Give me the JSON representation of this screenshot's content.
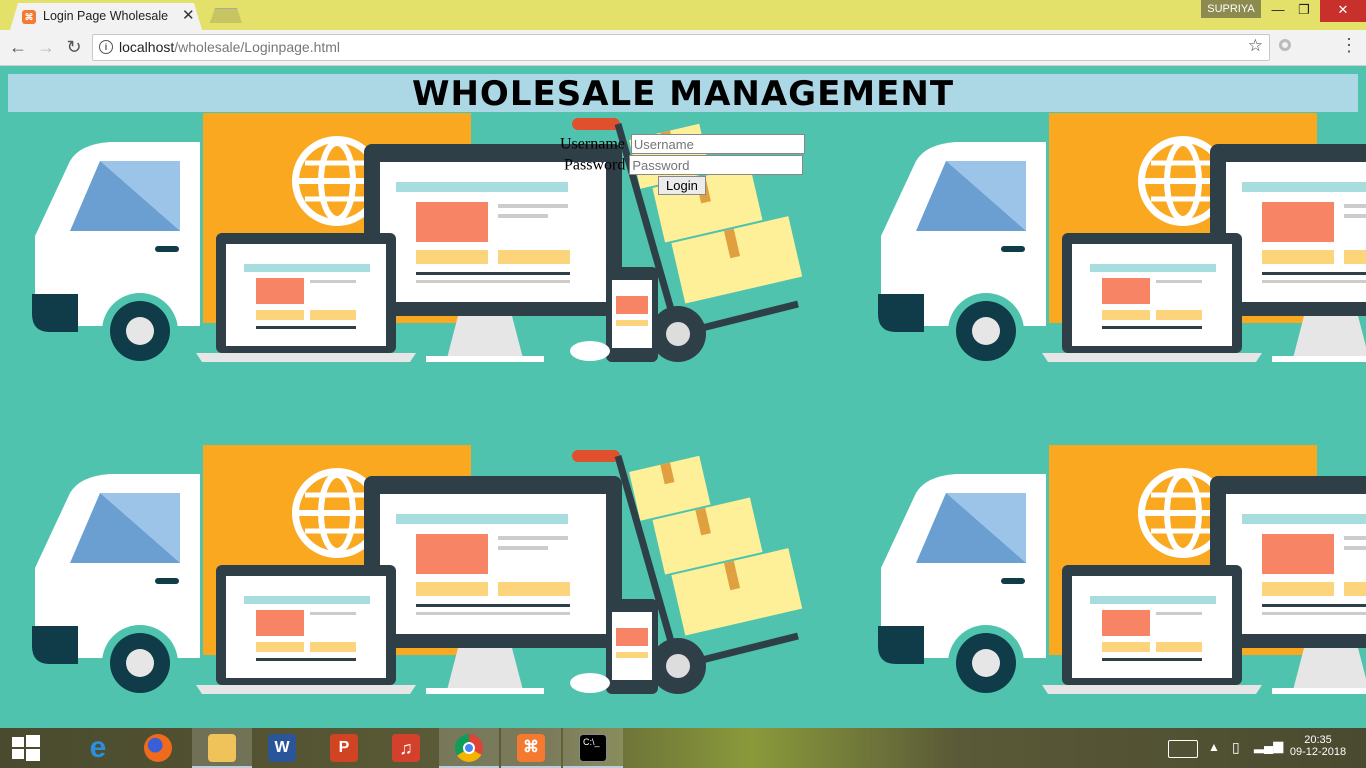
{
  "browser": {
    "tab_title": "Login Page Wholesale",
    "tab_close": "✕",
    "user_badge": "SUPRIYA",
    "url_host": "localhost",
    "url_path": "/wholesale/Loginpage.html"
  },
  "page": {
    "heading": "WHOLESALE MANAGEMENT",
    "login": {
      "username_label": "Username",
      "username_placeholder": "Username",
      "password_label": "Password",
      "password_placeholder": "Password",
      "button_label": "Login"
    }
  },
  "taskbar": {
    "apps": [
      "windows-start",
      "edge",
      "firefox",
      "file-explorer",
      "word",
      "powerpoint",
      "music",
      "chrome",
      "xampp",
      "cmd"
    ],
    "time": "20:35",
    "date": "09-12-2018"
  },
  "colors": {
    "page_bg": "#4fc3ad",
    "header_bg": "#acd8e6",
    "titlebar": "#e3e16a"
  }
}
